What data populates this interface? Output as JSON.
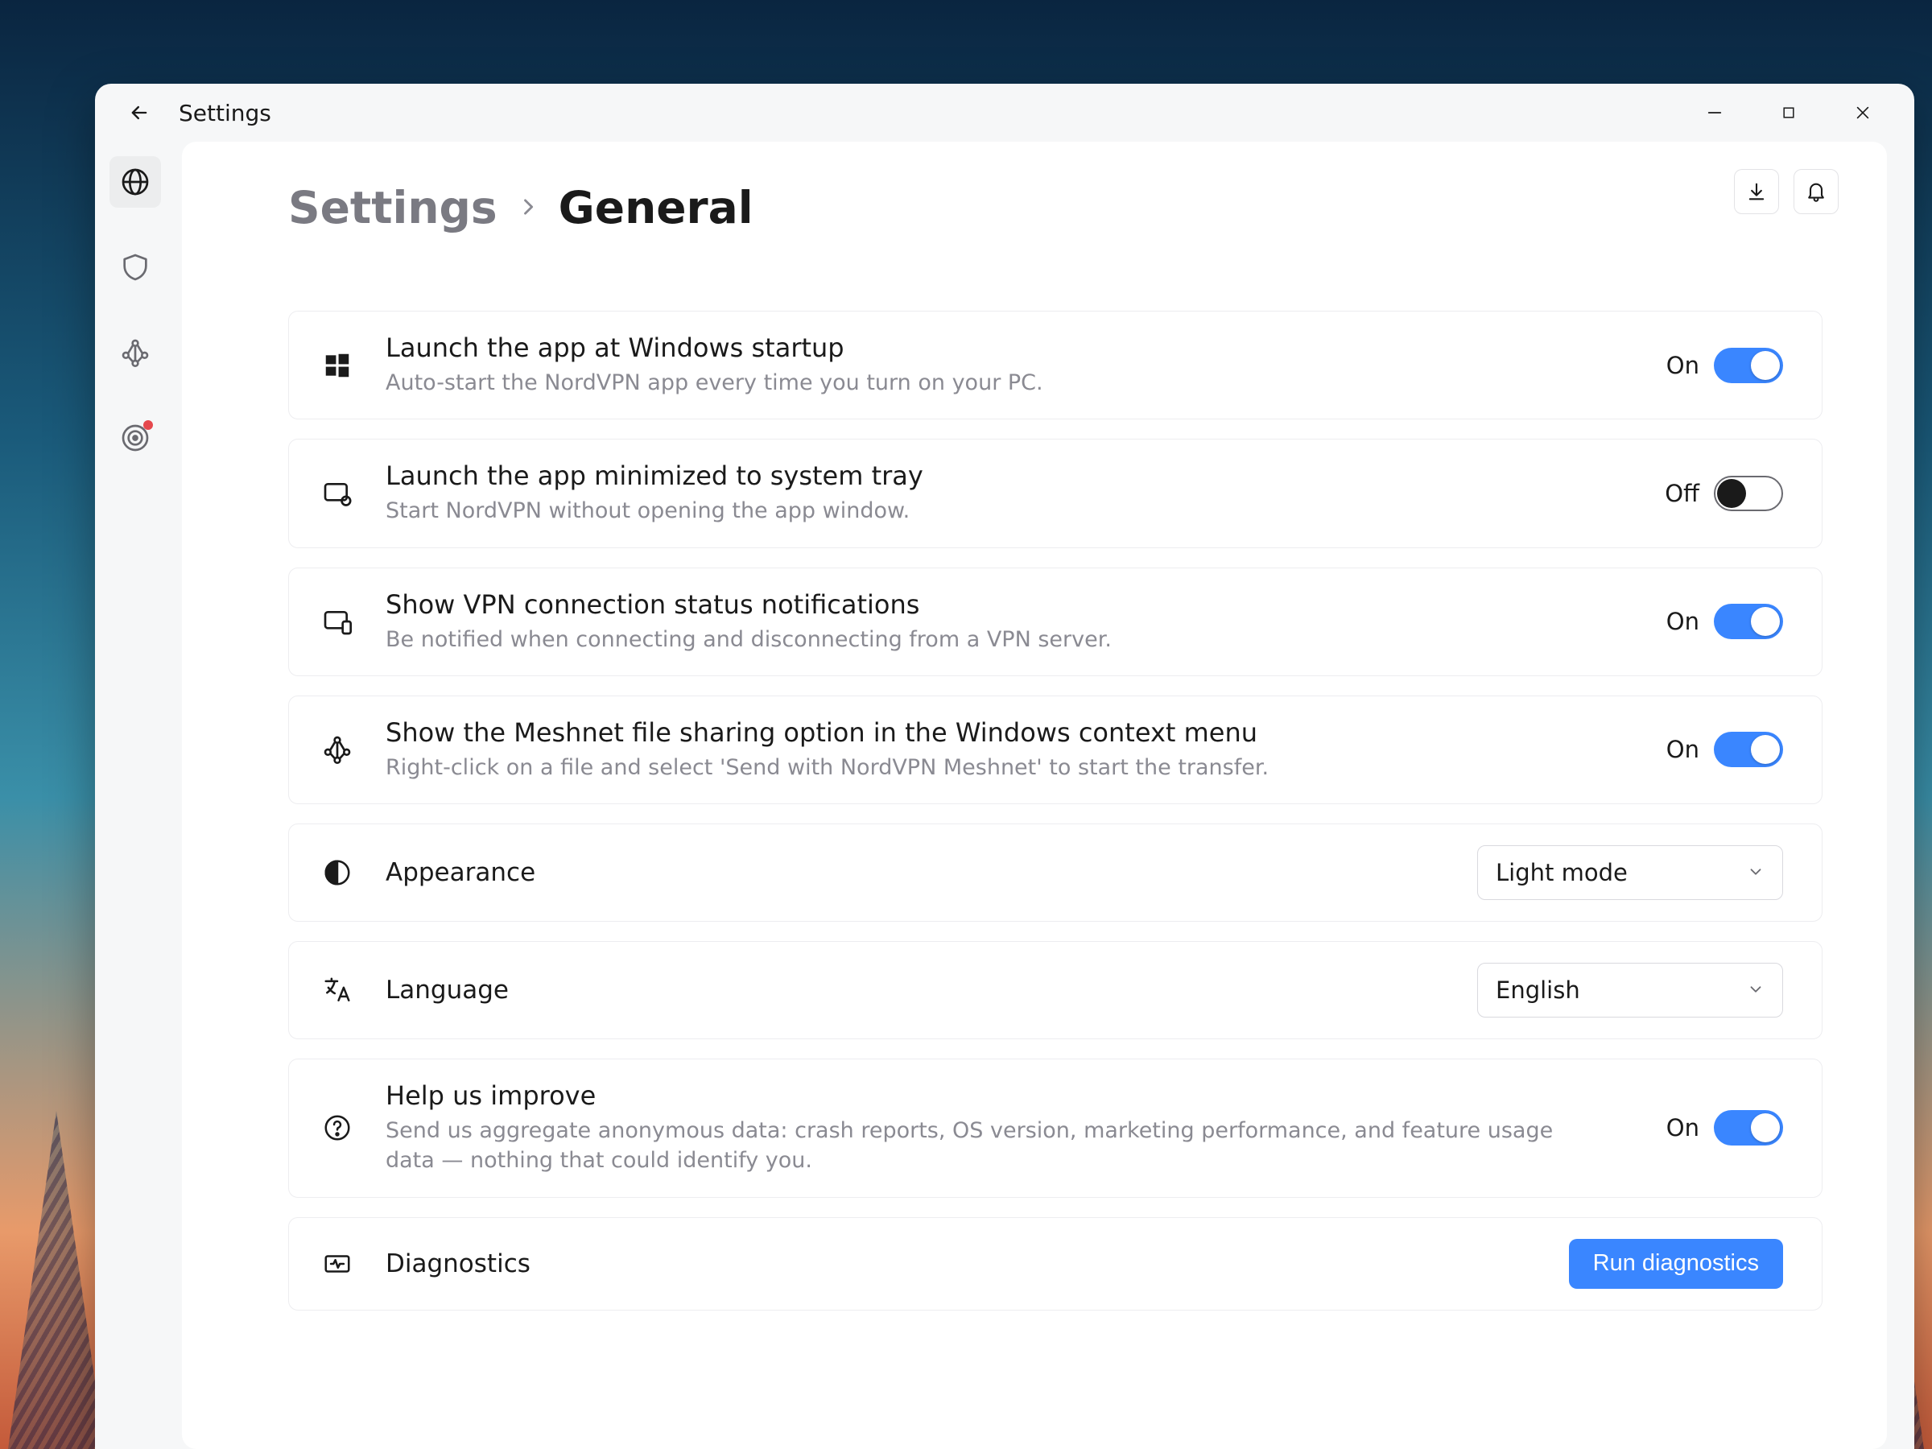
{
  "window": {
    "title": "Settings"
  },
  "breadcrumb": {
    "root": "Settings",
    "current": "General"
  },
  "topright": {
    "download": "download-icon",
    "bell": "bell-icon"
  },
  "sidebar": {
    "items": [
      {
        "name": "globe",
        "active": true
      },
      {
        "name": "shield",
        "active": false
      },
      {
        "name": "meshnet",
        "active": false
      },
      {
        "name": "target",
        "active": false,
        "badge": true
      }
    ]
  },
  "toggles": {
    "on_label": "On",
    "off_label": "Off"
  },
  "settings": {
    "launch_startup": {
      "title": "Launch the app at Windows startup",
      "desc": "Auto-start the NordVPN app every time you turn on your PC.",
      "state": "On"
    },
    "launch_tray": {
      "title": "Launch the app minimized to system tray",
      "desc": "Start NordVPN without opening the app window.",
      "state": "Off"
    },
    "status_notifications": {
      "title": "Show VPN connection status notifications",
      "desc": "Be notified when connecting and disconnecting from a VPN server.",
      "state": "On"
    },
    "meshnet_context": {
      "title": "Show the Meshnet file sharing option in the Windows context menu",
      "desc": "Right-click on a file and select 'Send with NordVPN Meshnet' to start the transfer.",
      "state": "On"
    },
    "appearance": {
      "title": "Appearance",
      "value": "Light mode"
    },
    "language": {
      "title": "Language",
      "value": "English"
    },
    "help_improve": {
      "title": "Help us improve",
      "desc": "Send us aggregate anonymous data: crash reports, OS version, marketing performance, and feature usage data — nothing that could identify you.",
      "state": "On"
    },
    "diagnostics": {
      "title": "Diagnostics",
      "button": "Run diagnostics"
    }
  }
}
